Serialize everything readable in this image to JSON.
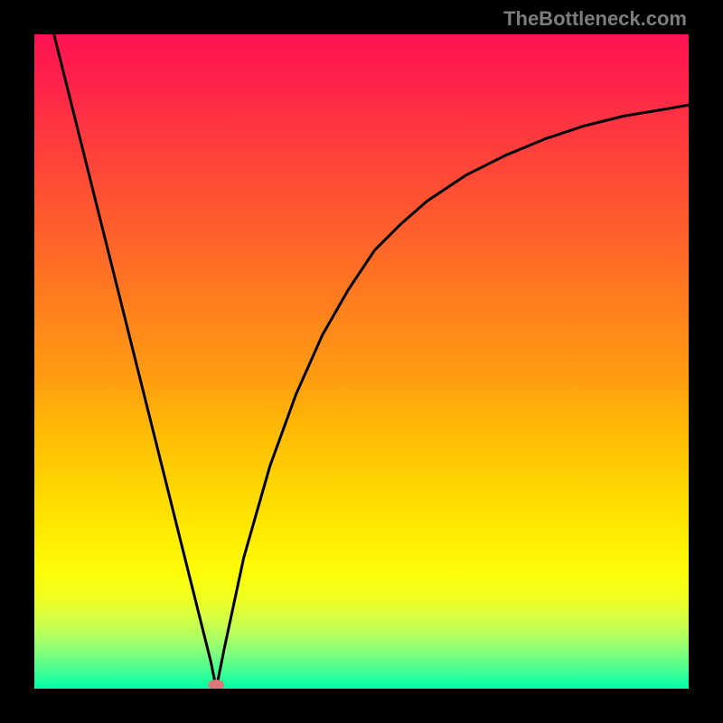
{
  "watermark": "TheBottleneck.com",
  "chart_data": {
    "type": "line",
    "title": "",
    "xlabel": "",
    "ylabel": "",
    "xlim": [
      0,
      100
    ],
    "ylim": [
      0,
      100
    ],
    "grid": false,
    "legend": false,
    "series": [
      {
        "name": "curve",
        "color": "#000000",
        "x": [
          3,
          6,
          9,
          12,
          15,
          18,
          21,
          24,
          27,
          27.8,
          29,
          32,
          36,
          40,
          44,
          48,
          52,
          56,
          60,
          66,
          72,
          78,
          84,
          90,
          96,
          100
        ],
        "y": [
          100,
          88,
          76,
          64,
          52,
          40,
          28,
          16,
          4,
          0,
          6,
          20,
          34,
          45,
          54,
          61,
          67,
          71,
          74.5,
          78.5,
          81.5,
          84,
          86,
          87.5,
          88.5,
          89.2
        ]
      }
    ],
    "annotations": [
      {
        "name": "min-marker",
        "x": 27.8,
        "y": 0,
        "color": "#d87a78",
        "shape": "ellipse"
      }
    ],
    "background_gradient": {
      "direction": "vertical",
      "stops": [
        {
          "pos": 0.0,
          "color": "#ff1452"
        },
        {
          "pos": 0.5,
          "color": "#ffa810"
        },
        {
          "pos": 0.8,
          "color": "#ffee04"
        },
        {
          "pos": 1.0,
          "color": "#00ffa8"
        }
      ]
    }
  }
}
